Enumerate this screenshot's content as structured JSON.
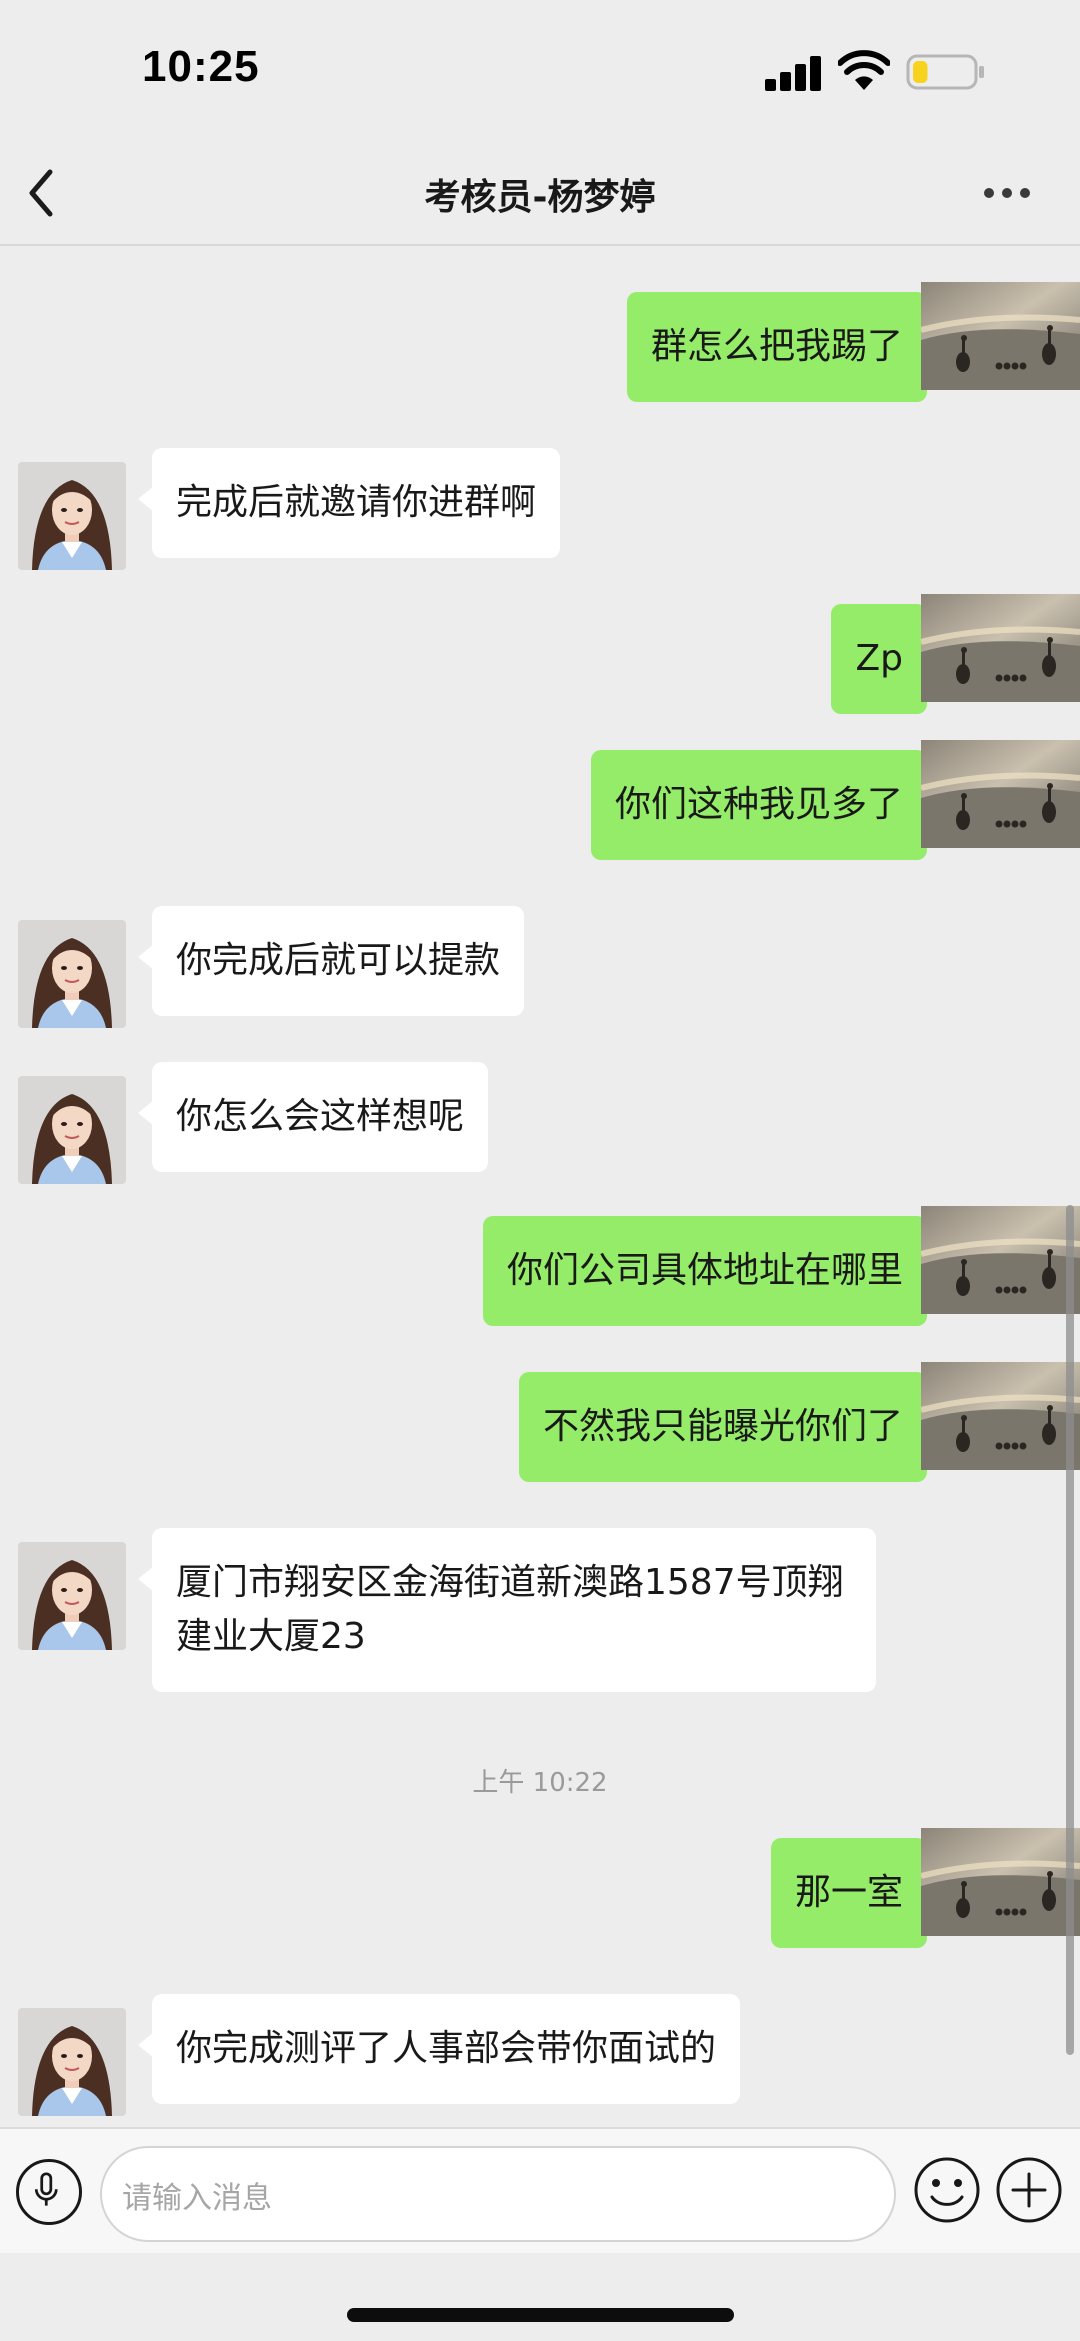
{
  "status_bar": {
    "time": "10:25"
  },
  "header": {
    "title": "考核员-杨梦婷"
  },
  "messages": [
    {
      "from": "self",
      "text": "群怎么把我踢了"
    },
    {
      "from": "other",
      "text": "完成后就邀请你进群啊"
    },
    {
      "from": "self",
      "text": "Zp"
    },
    {
      "from": "self",
      "text": "你们这种我见多了"
    },
    {
      "from": "other",
      "text": "你完成后就可以提款"
    },
    {
      "from": "other",
      "text": "你怎么会这样想呢"
    },
    {
      "from": "self",
      "text": "你们公司具体地址在哪里"
    },
    {
      "from": "self",
      "text": "不然我只能曝光你们了"
    },
    {
      "from": "other",
      "text": "厦门市翔安区金海街道新澳路1587号顶翔\n建业大厦23"
    },
    {
      "from": "self",
      "text": "那一室"
    },
    {
      "from": "other",
      "text": "你完成测评了人事部会带你面试的"
    }
  ],
  "time_divider": "上午 10:22",
  "input": {
    "placeholder": "请输入消息"
  },
  "icons": {
    "back": "chevron-left-icon",
    "more": "more-dots-icon",
    "voice": "microphone-icon",
    "emoji": "smiley-icon",
    "plus": "plus-icon"
  },
  "colors": {
    "background": "#ededed",
    "outgoing_bubble": "#95ec69",
    "incoming_bubble": "#ffffff",
    "battery_level": "#f7d21e"
  },
  "battery_level": 0.25
}
